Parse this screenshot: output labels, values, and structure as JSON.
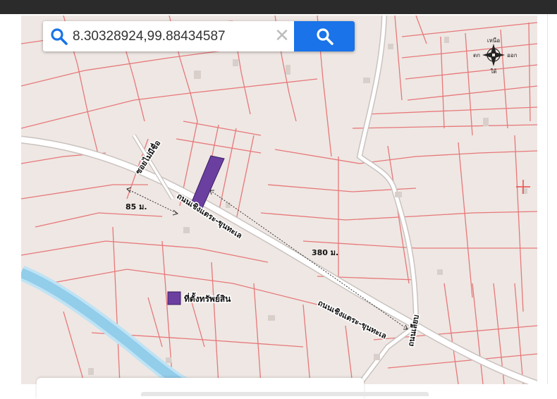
{
  "search": {
    "value": "8.30328924,99.88434587",
    "clear_symbol": "✕"
  },
  "compass": {
    "north": "เหนือ",
    "south": "ใต้",
    "east": "ออก",
    "west": "ตก"
  },
  "roads": {
    "main_road_1": "ถนนเชิงแตระ-ขุนทะเล",
    "main_road_2": "ถนนเชิงแตระ-ขุนทะเล",
    "unnamed_alley": "ซอยไม่มีชื่อ",
    "side_road": "ถนนเลียบ"
  },
  "measurements": {
    "distance_short": "85 ม.",
    "distance_long": "380 ม."
  },
  "legend": {
    "label": "ที่ตั้งทรัพย์สิน",
    "color": "#6b3fa0"
  },
  "colors": {
    "map_background": "#efe7e3",
    "parcel_lines": "#e6787a",
    "road_fill": "#ffffff",
    "canal": "#9fd3ee",
    "search_button": "#1a73e8",
    "parcel_highlight": "#6b3fa0"
  }
}
